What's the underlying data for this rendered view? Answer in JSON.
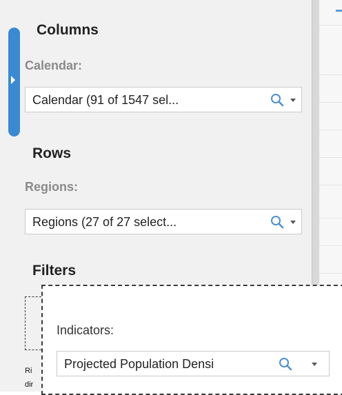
{
  "sections": {
    "columns": {
      "title": "Columns",
      "label": "Calendar:",
      "value": "Calendar (91 of 1547 sel..."
    },
    "rows": {
      "title": "Rows",
      "label": "Regions:",
      "value": "Regions (27 of 27 select..."
    },
    "filters": {
      "title": "Filters",
      "hidden_lines": [
        "Ri",
        "dir"
      ]
    }
  },
  "dragged_filter": {
    "label": "Indicators:",
    "value": "Projected Population Densi"
  },
  "colors": {
    "panel_bg": "#f1f1f1",
    "tab_accent": "#3a8ad3",
    "label_grey": "#8a8a8a",
    "search_icon_blue": "#4a8fd6"
  },
  "icons": {
    "search": "magnifier-icon",
    "dropdown": "caret-down-icon",
    "collapse": "triangle-right-icon"
  }
}
